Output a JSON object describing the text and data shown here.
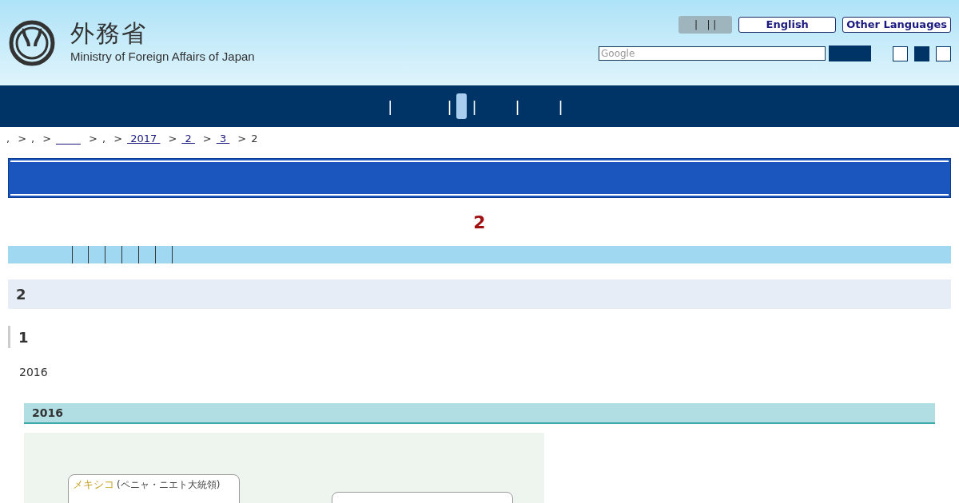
{
  "header": {
    "logo_title": "外務省",
    "logo_subtitle": "Ministry of Foreign Affairs of Japan",
    "utility_box": "|   | |",
    "language_links": [
      "English",
      "Other Languages"
    ],
    "search": {
      "placeholder": "Google"
    },
    "text_size_buttons": [
      {
        "selected": false
      },
      {
        "selected": true
      },
      {
        "selected": false
      }
    ]
  },
  "nav": {
    "items": [
      {
        "selected": false,
        "label": "|"
      },
      {
        "selected": false,
        "label": "|"
      },
      {
        "selected": true
      },
      {
        "selected": false,
        "label": "|"
      },
      {
        "selected": false,
        "label": "|"
      },
      {
        "selected": false,
        "label": "|"
      }
    ]
  },
  "breadcrumb": {
    "separator": ">",
    "items": [
      {
        "kind": "text",
        "label": ","
      },
      {
        "kind": "text",
        "label": ","
      },
      {
        "kind": "blank-link"
      },
      {
        "kind": "text",
        "label": ","
      },
      {
        "kind": "link",
        "label": "2017"
      },
      {
        "kind": "link",
        "label": "2"
      },
      {
        "kind": "link",
        "label": "3"
      },
      {
        "kind": "text",
        "label": "2"
      }
    ]
  },
  "page_title": "2",
  "section_heading": "2",
  "subheading": "1",
  "paragraph": "2016",
  "figure": {
    "caption": "2016",
    "boxes": [
      {
        "country": "メキシコ",
        "leader": "(ペニャ・ニエト大統領)"
      }
    ]
  }
}
